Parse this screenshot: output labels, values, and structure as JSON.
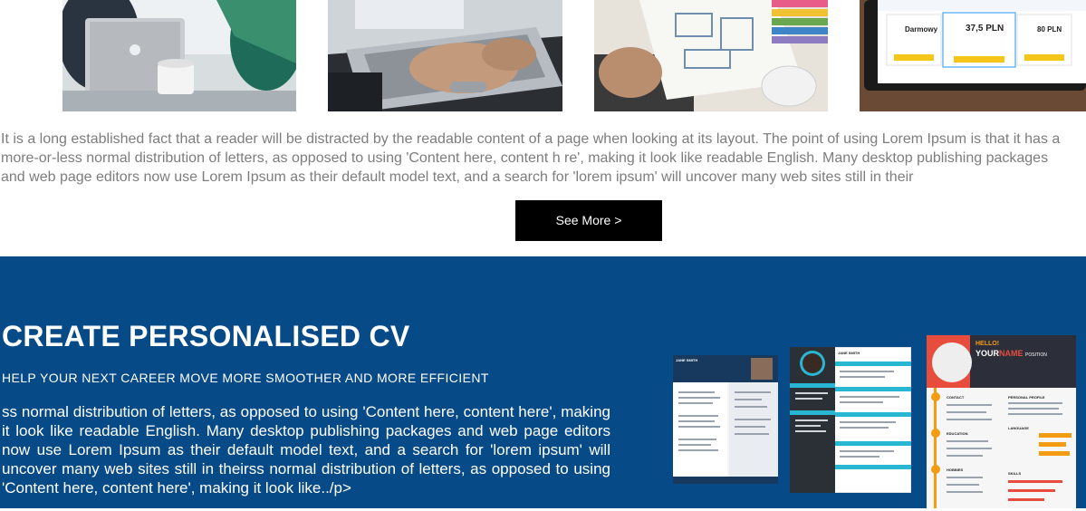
{
  "gallery": {
    "items": [
      {
        "name": "laptop-team-photo",
        "icon": "laptop-photo"
      },
      {
        "name": "typing-laptop-photo",
        "icon": "typing-photo"
      },
      {
        "name": "wireframe-paper-photo",
        "icon": "wireframe-photo"
      },
      {
        "name": "pricing-tablet-photo",
        "icon": "tablet-photo"
      }
    ],
    "pricing_card": {
      "plan_free": "Darmowy",
      "plan_mid": "37,5 PLN",
      "plan_top": "80 PLN"
    }
  },
  "intro": {
    "lines": [
      "It is a long established fact that a reader will be distracted by the readable content of a page when looking at its layout. The point of using Lorem Ipsum is that it has a",
      "more-or-less normal distribution of letters, as opposed to using 'Content here, content h re', making it look like readable English. Many desktop publishing packages",
      "and web page editors now use Lorem Ipsum as their default model text, and a search for 'lorem ipsum' will uncover many web sites still in their"
    ],
    "see_more_label": "See More >"
  },
  "cv_section": {
    "title": "CREATE PERSONALISED CV",
    "subtitle": "HELP YOUR NEXT CAREER MOVE MORE SMOOTHER AND MORE EFFICIENT",
    "body": "ss normal distribution of letters, as opposed to using 'Content here, content here', making it look like readable English. Many desktop publishing packages and web page editors now use Lorem Ipsum as their default model text, and a search for 'lorem ipsum' will uncover many web sites still in theirss normal distribution of letters, as opposed to using 'Content here, content here', making it look like../p>",
    "colors": {
      "band": "#074a88",
      "accent_cyan": "#29b6d2",
      "accent_orange": "#f39c12",
      "accent_red": "#e74c3c"
    },
    "templates": {
      "first": {
        "name": "JANE SMITH"
      },
      "second": {
        "name": "JANE SMITH"
      },
      "third": {
        "greeting": "HELLO!",
        "name_prefix": "YOUR",
        "name_suffix": "NAME",
        "position": "POSITION",
        "headings": [
          "CONTACT",
          "PERSONAL PROFILE",
          "EDUCATION",
          "LANGUAGE",
          "HOBBIES",
          "SKILLS"
        ]
      }
    }
  }
}
